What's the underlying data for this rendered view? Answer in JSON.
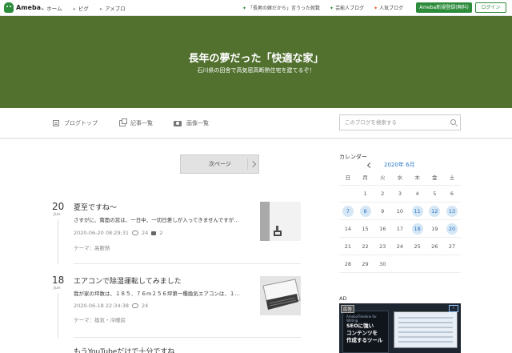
{
  "topbar": {
    "logo_text": "Ameba",
    "nav": [
      "ホーム",
      "ピグ",
      "アメブロ"
    ],
    "right_links": [
      "「長男の嫁だから」言うった就数",
      "芸能人ブログ",
      "人気ブログ"
    ],
    "signup_label": "Ameba新規登録(無料)",
    "login_label": "ログイン"
  },
  "header": {
    "title": "長年の夢だった「快適な家」",
    "description": "石川県の田舎で高気密高断熱住宅を建てるぞ！"
  },
  "blognav": {
    "items": [
      "ブログトップ",
      "記事一覧",
      "画像一覧"
    ],
    "search_placeholder": "このブログを検索する"
  },
  "pager": {
    "next_label": "次ページ"
  },
  "entries": [
    {
      "day": "20",
      "month": "Jun",
      "title": "夏至ですね〜",
      "excerpt": "さすがに、南面の窓は、一日中、一切日差しが入ってきませんですが…",
      "datetime": "2020-06-20 08:29:31",
      "likes": "24",
      "comments": "2",
      "theme": "テーマ：高断熱"
    },
    {
      "day": "18",
      "month": "Jun",
      "title": "エアコンで除湿運転してみました",
      "excerpt": "我が家の坪数は、１８５．７６m２５６坪第一種換気エアコンは、１…",
      "datetime": "2020-06-18 22:34:38",
      "likes": "24",
      "theme": "テーマ：換気・冷暖房"
    },
    {
      "title": "もうYouTubeだけで十分ですね"
    }
  ],
  "calendar": {
    "title": "カレンダー",
    "month_label": "2020年 6月",
    "weekdays": [
      "日",
      "月",
      "火",
      "水",
      "木",
      "金",
      "土"
    ],
    "weeks": [
      [
        "",
        "1",
        "2",
        "3",
        "4",
        "5",
        "6"
      ],
      [
        "7",
        "8",
        "9",
        "10",
        "11",
        "12",
        "13"
      ],
      [
        "14",
        "15",
        "16",
        "17",
        "18",
        "19",
        "20"
      ],
      [
        "21",
        "22",
        "23",
        "24",
        "25",
        "26",
        "27"
      ],
      [
        "28",
        "29",
        "30",
        "",
        "",
        "",
        ""
      ]
    ],
    "highlighted": [
      "7",
      "8",
      "11",
      "12",
      "13",
      "18",
      "20"
    ]
  },
  "ad": {
    "label": "AD",
    "tag": "広告",
    "book_subtitle": "AmebaTimeline for Writing",
    "book_title": "SEOに強い\nコンテンツを\n作成するツール"
  },
  "colors": {
    "brand_green": "#2d8c3c",
    "header_bg": "#52712f",
    "link_blue": "#2977c9"
  }
}
